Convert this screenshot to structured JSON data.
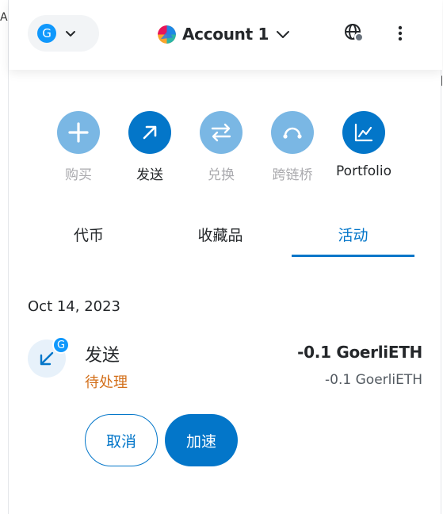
{
  "background": {
    "left_fragment": "A",
    "right_fragment": "图"
  },
  "header": {
    "network_avatar_letter": "G",
    "account_name": "Account 1",
    "icons": {
      "network_chevron": "chevron-down-icon",
      "account_chevron": "chevron-down-icon",
      "connected_sites": "globe-icon",
      "menu": "more-vertical-icon"
    }
  },
  "actions": [
    {
      "label": "购买",
      "icon": "plus-icon",
      "state": "disabled"
    },
    {
      "label": "发送",
      "icon": "arrow-up-right-icon",
      "state": "active"
    },
    {
      "label": "兑换",
      "icon": "swap-icon",
      "state": "disabled"
    },
    {
      "label": "跨链桥",
      "icon": "bridge-icon",
      "state": "disabled"
    },
    {
      "label": "Portfolio",
      "icon": "chart-icon",
      "state": "active"
    }
  ],
  "tabs": [
    {
      "label": "代币",
      "selected": false
    },
    {
      "label": "收藏品",
      "selected": false
    },
    {
      "label": "活动",
      "selected": true
    }
  ],
  "activity": {
    "date": "Oct 14, 2023",
    "transaction": {
      "badge_letter": "G",
      "title": "发送",
      "status": "待处理",
      "amount": "-0.1 GoerliETH",
      "secondary_amount": "-0.1 GoerliETH",
      "cancel_label": "取消",
      "speed_up_label": "加速"
    }
  },
  "colors": {
    "primary": "#0376c9",
    "primary_disabled": "#7ab7e4",
    "pending": "#d36f1a",
    "network": "#1098fc"
  }
}
